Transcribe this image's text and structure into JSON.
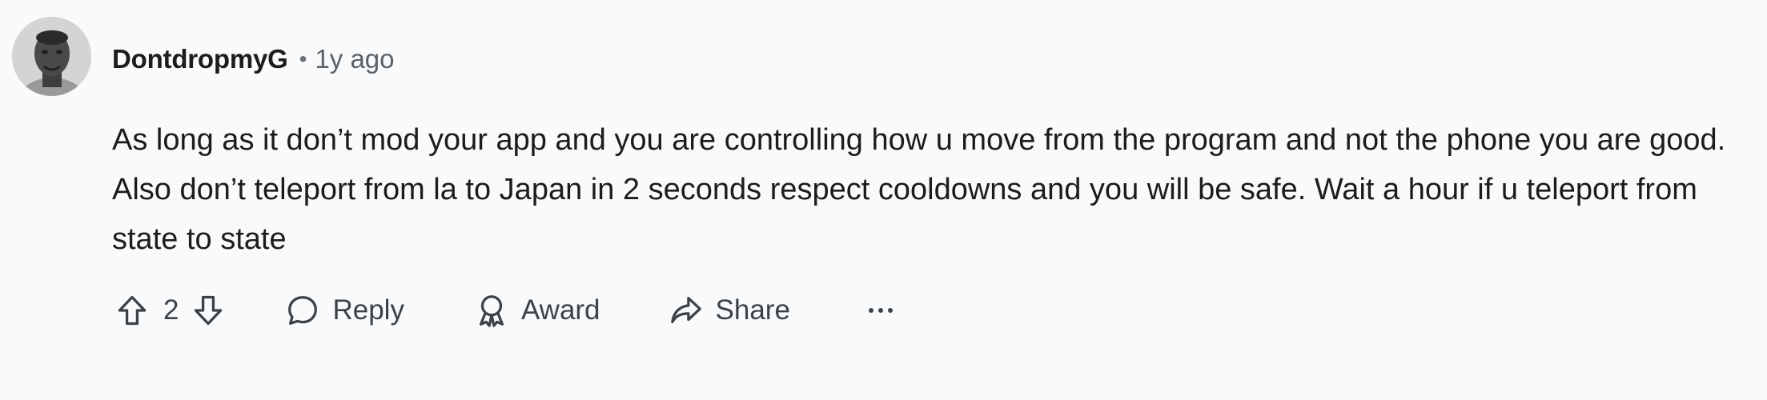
{
  "comment": {
    "author": "DontdropmyG",
    "separator": "•",
    "timestamp": "1y ago",
    "body": "As long as it don’t mod your app and you are controlling how u move from the program and not the phone you are good. Also don’t teleport from la to Japan in 2 seconds respect cooldowns and you will be safe. Wait a hour if u teleport from state to state"
  },
  "actions": {
    "score": "2",
    "reply_label": "Reply",
    "award_label": "Award",
    "share_label": "Share"
  },
  "icons": {
    "upvote": "upvote-arrow-icon",
    "downvote": "downvote-arrow-icon",
    "reply": "speech-bubble-icon",
    "award": "award-ribbon-icon",
    "share": "share-arrow-icon",
    "more": "ellipsis-icon"
  },
  "colors": {
    "background": "#f9fafc",
    "text": "#1a1c1e",
    "muted": "#5c6166",
    "action": "#3d4247"
  }
}
